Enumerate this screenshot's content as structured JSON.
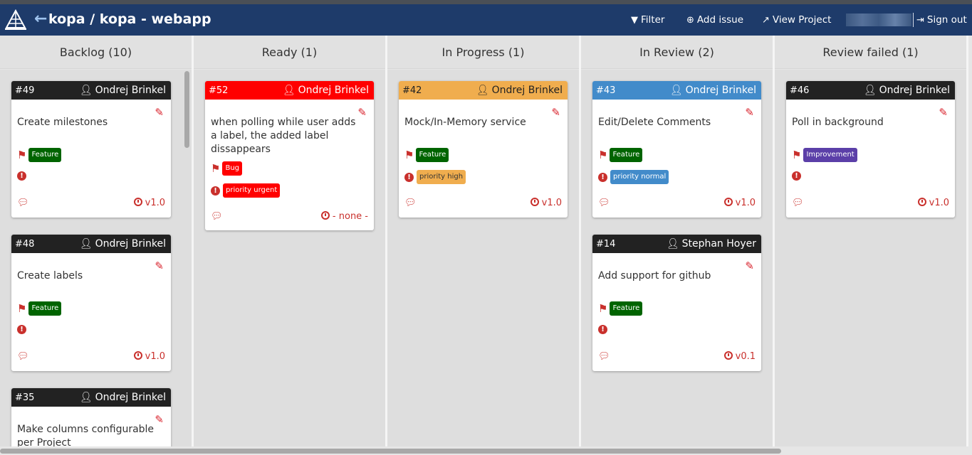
{
  "app": {
    "title": "kopa / kopa - webapp",
    "nav": {
      "filter": "Filter",
      "add_issue": "Add issue",
      "view_project": "View Project",
      "sign_out": "Sign out"
    }
  },
  "colors": {
    "navbar": "#1e3b6a",
    "head_default": "#222222",
    "head_urgent": "#ff0000",
    "head_high": "#f0ad4e",
    "head_normal": "#428bca",
    "label_feature": "#006400",
    "label_bug": "#ff0000",
    "label_improvement": "#5b3fa8",
    "label_priority_urgent": "#ff0000",
    "label_priority_high": "#f0ad4e",
    "label_priority_normal": "#428bca"
  },
  "columns": [
    {
      "title": "Backlog (10)",
      "cards": [
        {
          "num": "#49",
          "assignee": "Ondrej Brinkel",
          "title": "Create milestones",
          "labels": [
            "Feature"
          ],
          "priority": "",
          "milestone": "v1.0"
        },
        {
          "num": "#48",
          "assignee": "Ondrej Brinkel",
          "title": "Create labels",
          "labels": [
            "Feature"
          ],
          "priority": "",
          "milestone": "v1.0"
        },
        {
          "num": "#35",
          "assignee": "Ondrej Brinkel",
          "title": "Make columns configurable per Project"
        }
      ]
    },
    {
      "title": "Ready (1)",
      "cards": [
        {
          "num": "#52",
          "assignee": "Ondrej Brinkel",
          "title": "when polling while user adds a label, the added label dissappears",
          "labels": [
            "Bug"
          ],
          "priority": "priority urgent",
          "milestone": "- none -"
        }
      ]
    },
    {
      "title": "In Progress (1)",
      "cards": [
        {
          "num": "#42",
          "assignee": "Ondrej Brinkel",
          "title": "Mock/In-Memory service",
          "labels": [
            "Feature"
          ],
          "priority": "priority high",
          "milestone": "v1.0"
        }
      ]
    },
    {
      "title": "In Review (2)",
      "cards": [
        {
          "num": "#43",
          "assignee": "Ondrej Brinkel",
          "title": "Edit/Delete Comments",
          "labels": [
            "Feature"
          ],
          "priority": "priority normal",
          "milestone": "v1.0"
        },
        {
          "num": "#14",
          "assignee": "Stephan Hoyer",
          "title": "Add support for github",
          "labels": [
            "Feature"
          ],
          "priority": "",
          "milestone": "v0.1"
        }
      ]
    },
    {
      "title": "Review failed (1)",
      "cards": [
        {
          "num": "#46",
          "assignee": "Ondrej Brinkel",
          "title": "Poll in background",
          "labels": [
            "Improvement"
          ],
          "priority": "",
          "milestone": "v1.0"
        }
      ]
    }
  ],
  "icons": {
    "back": "arrow-left-icon",
    "filter": "filter-icon",
    "add": "plus-circle-icon",
    "external": "external-link-icon",
    "signout": "sign-out-icon",
    "person": "user-icon",
    "edit": "pencil-icon",
    "tags": "tags-icon",
    "priority": "exclamation-circle-icon",
    "comments": "comments-icon",
    "milestone": "clock-icon"
  }
}
